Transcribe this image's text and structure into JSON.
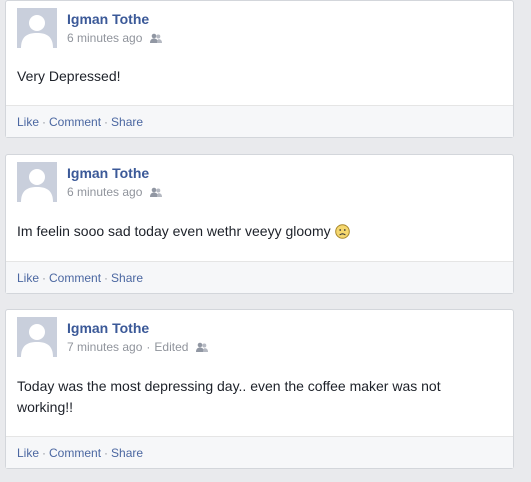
{
  "colors": {
    "link": "#3b5998",
    "action": "#4b67a1",
    "meta": "#90949c",
    "text": "#1d2129",
    "background": "#e9eaed"
  },
  "posts": [
    {
      "author": "Igman Tothe",
      "time": "6 minutes ago",
      "edited": "",
      "audience_icon": "friends-icon",
      "text": "Very Depressed!",
      "emoji": "",
      "actions": {
        "like": "Like",
        "comment": "Comment",
        "share": "Share",
        "sep": "·"
      }
    },
    {
      "author": "Igman Tothe",
      "time": "6 minutes ago",
      "edited": "",
      "audience_icon": "friends-icon",
      "text": "Im feelin sooo sad today even wethr veeyy gloomy",
      "emoji": "frown-emoticon-icon",
      "actions": {
        "like": "Like",
        "comment": "Comment",
        "share": "Share",
        "sep": "·"
      }
    },
    {
      "author": "Igman Tothe",
      "time": "7 minutes ago",
      "edited": "Edited",
      "audience_icon": "friends-icon",
      "text": "Today was the most depressing day.. even the coffee maker was not working!!",
      "emoji": "",
      "actions": {
        "like": "Like",
        "comment": "Comment",
        "share": "Share",
        "sep": "·"
      }
    }
  ]
}
